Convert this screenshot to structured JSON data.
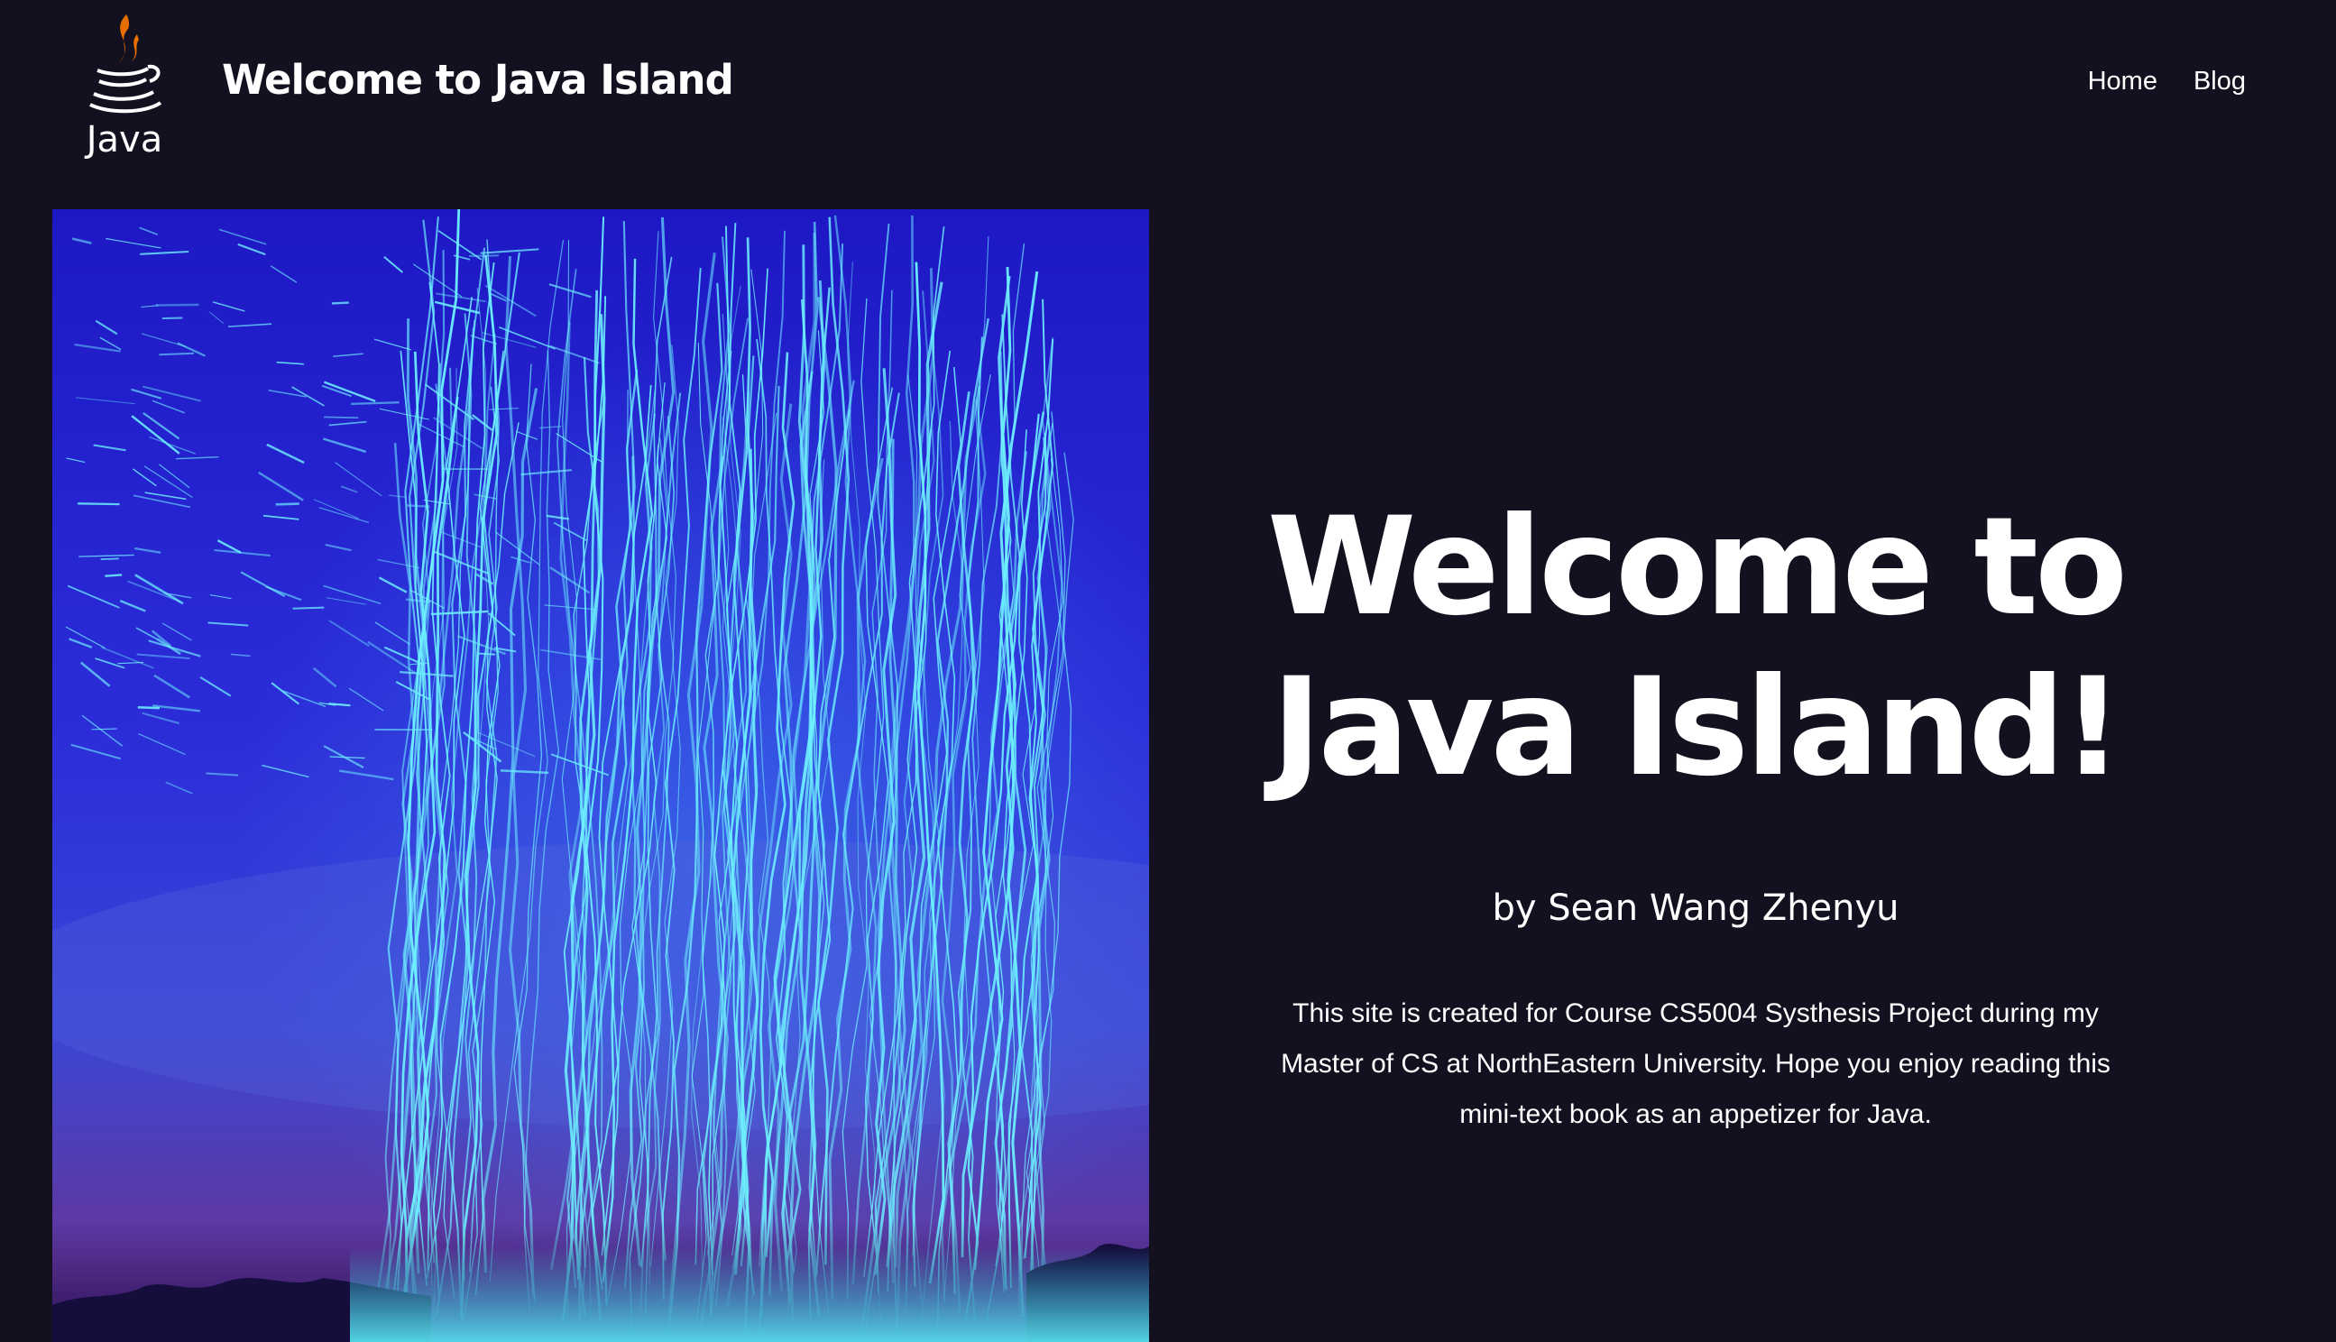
{
  "header": {
    "logo_icon": "java-coffee-cup-logo",
    "logo_text": "Java",
    "site_title": "Welcome to Java Island",
    "nav": [
      {
        "label": "Home"
      },
      {
        "label": "Blog"
      }
    ]
  },
  "hero": {
    "image_icon": "blue-light-trails-photo",
    "heading_line1": "Welcome to",
    "heading_line2": "Java Island!",
    "byline": "by Sean Wang Zhenyu",
    "description": "This site is created for Course CS5004 Systhesis Project during my Master of CS at NorthEastern University. Hope you enjoy reading this mini-text book as an appetizer for Java."
  },
  "colors": {
    "background": "#13111f",
    "text": "#ffffff",
    "java_orange": "#e76f00",
    "image_sky": "#2420c8",
    "light_trail": "#6ef0ff"
  }
}
